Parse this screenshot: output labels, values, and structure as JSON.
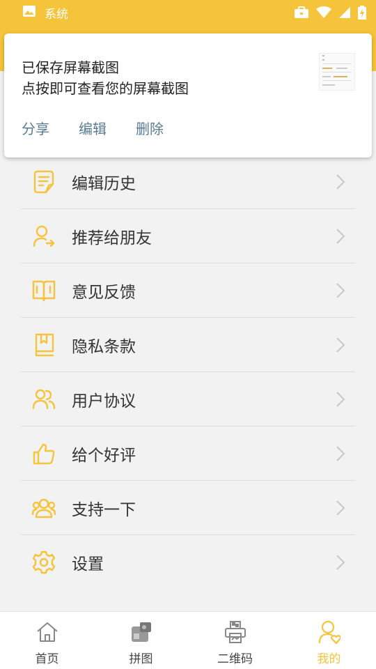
{
  "status_bar": {
    "app_name": "系统"
  },
  "notification": {
    "line1": "已保存屏幕截图",
    "line2": "点按即可查看您的屏幕截图",
    "actions": [
      "分享",
      "编辑",
      "删除"
    ]
  },
  "menu": {
    "items": [
      {
        "label": "编辑历史",
        "icon": "edit-document-icon"
      },
      {
        "label": "推荐给朋友",
        "icon": "share-user-icon"
      },
      {
        "label": "意见反馈",
        "icon": "feedback-book-icon"
      },
      {
        "label": "隐私条款",
        "icon": "bookmark-book-icon"
      },
      {
        "label": "用户协议",
        "icon": "users-icon"
      },
      {
        "label": "给个好评",
        "icon": "thumbs-up-icon"
      },
      {
        "label": "支持一下",
        "icon": "group-icon"
      },
      {
        "label": "设置",
        "icon": "gear-icon"
      }
    ]
  },
  "bottom_nav": {
    "items": [
      {
        "label": "首页",
        "icon": "home-icon"
      },
      {
        "label": "拼图",
        "icon": "puzzle-icon"
      },
      {
        "label": "二维码",
        "icon": "qr-print-icon"
      },
      {
        "label": "我的",
        "icon": "user-heart-icon",
        "active": true
      }
    ]
  },
  "colors": {
    "accent": "#f5c43a",
    "link": "#5a7a94",
    "text": "#333333"
  }
}
